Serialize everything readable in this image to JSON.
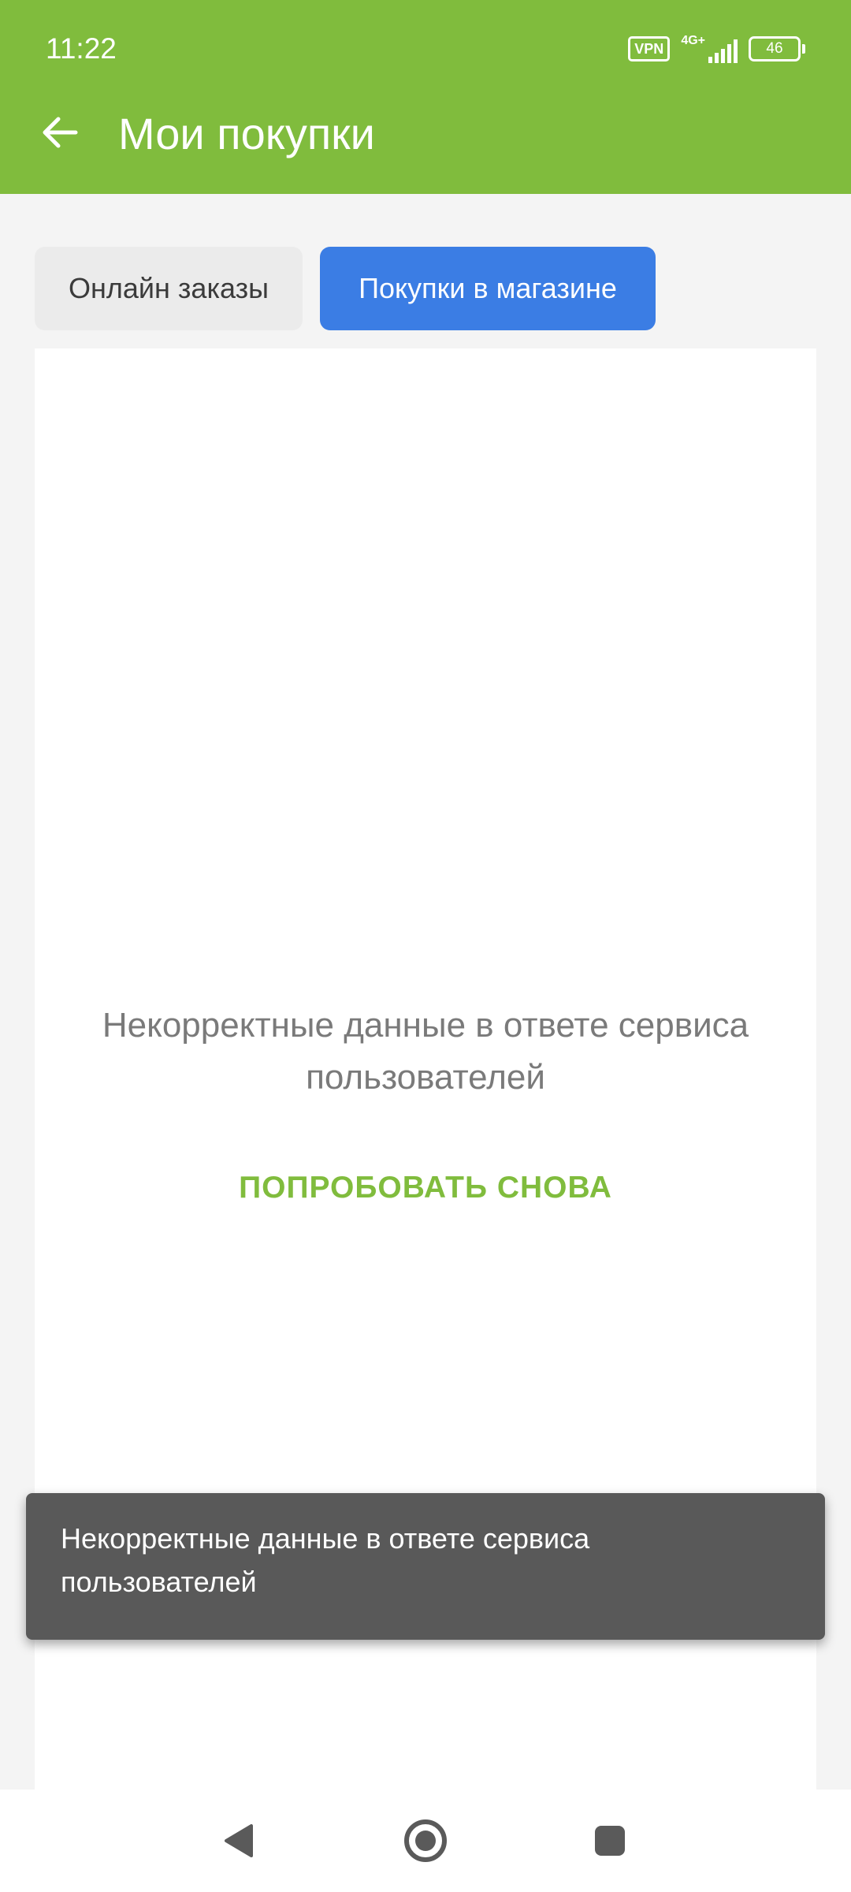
{
  "status_bar": {
    "time": "11:22",
    "vpn_label": "VPN",
    "network_label": "4G+",
    "battery_level": "46"
  },
  "header": {
    "title": "Мои покупки",
    "back_icon": "arrow-left-icon",
    "background_color": "#80bc3d"
  },
  "tabs": [
    {
      "label": "Онлайн заказы",
      "active": false
    },
    {
      "label": "Покупки в магазине",
      "active": true
    }
  ],
  "error": {
    "message": "Некорректные данные в ответе сервиса пользователей",
    "retry_label": "ПОПРОБОВАТЬ СНОВА"
  },
  "snackbar": {
    "message": "Некорректные данные в ответе сервиса пользователей"
  },
  "navigation": {
    "back_icon": "triangle-back-icon",
    "home_icon": "circle-home-icon",
    "recent_icon": "square-recent-icon"
  },
  "colors": {
    "accent_green": "#80bc3d",
    "active_tab_blue": "#3b7de4",
    "snackbar_gray": "#595959"
  }
}
